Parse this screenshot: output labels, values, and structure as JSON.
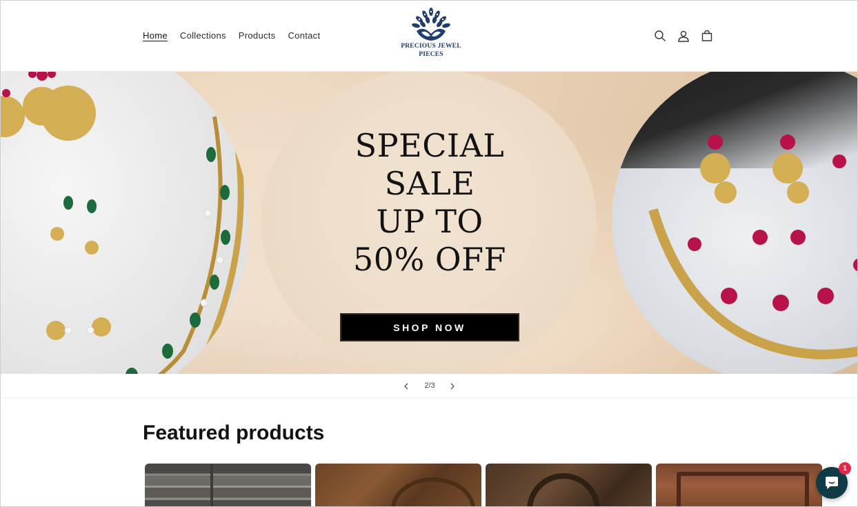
{
  "header": {
    "nav": [
      {
        "label": "Home",
        "active": true
      },
      {
        "label": "Collections",
        "active": false
      },
      {
        "label": "Products",
        "active": false
      },
      {
        "label": "Contact",
        "active": false
      }
    ],
    "logo": {
      "line1": "PRECIOUS JEWEL",
      "line2": "PIECES",
      "brand_color": "#1f3e6e"
    },
    "icons": [
      "search-icon",
      "account-icon",
      "cart-icon"
    ]
  },
  "hero": {
    "headline_lines": [
      "SPECIAL",
      "SALE",
      "UP TO",
      "50% OFF"
    ],
    "button_label": "SHOP NOW"
  },
  "slideshow": {
    "counter": "2/3"
  },
  "featured": {
    "title": "Featured products"
  },
  "chat": {
    "badge_count": "1",
    "color": "#0f3b47",
    "badge_color": "#e0284a"
  }
}
